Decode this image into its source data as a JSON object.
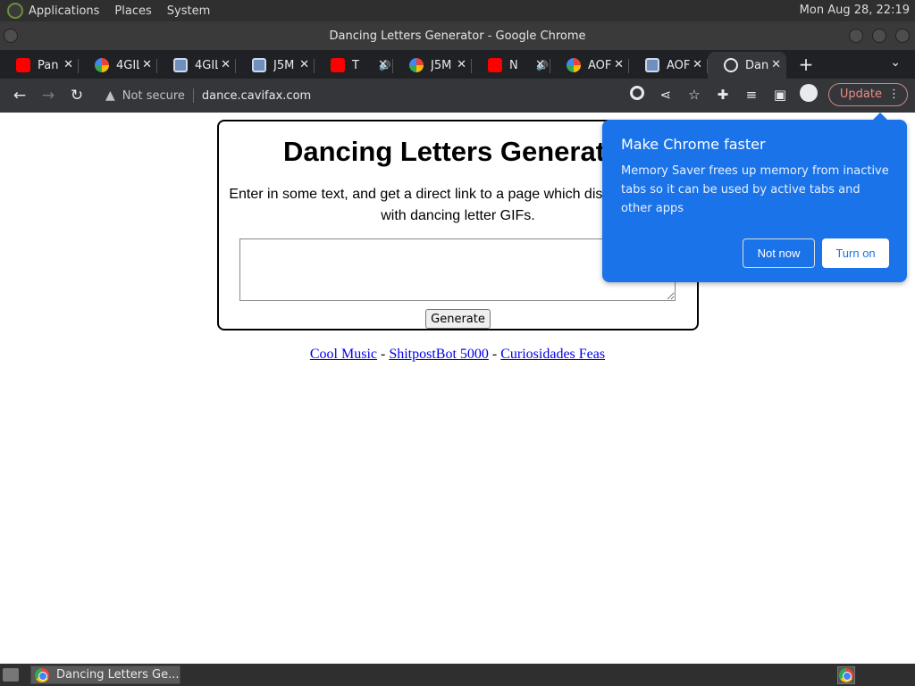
{
  "system_panel": {
    "menus": [
      "Applications",
      "Places",
      "System"
    ],
    "clock": "Mon Aug 28, 22:19"
  },
  "window": {
    "title": "Dancing Letters Generator - Google Chrome"
  },
  "tabs": [
    {
      "label": "Pan",
      "favicon": "youtube-icon",
      "muted": false
    },
    {
      "label": "4GIL",
      "favicon": "pinwheel-icon",
      "muted": false
    },
    {
      "label": "4GIL",
      "favicon": "image-icon",
      "muted": false
    },
    {
      "label": "J5M",
      "favicon": "image-icon",
      "muted": false
    },
    {
      "label": "T",
      "favicon": "youtube-icon",
      "muted": true
    },
    {
      "label": "J5M",
      "favicon": "pinwheel-icon",
      "muted": false
    },
    {
      "label": "N",
      "favicon": "youtube-icon",
      "muted": true
    },
    {
      "label": "AOF",
      "favicon": "pinwheel-icon",
      "muted": false
    },
    {
      "label": "AOF",
      "favicon": "image-icon",
      "muted": false
    },
    {
      "label": "Dan",
      "favicon": "globe-icon",
      "muted": false,
      "active": true
    }
  ],
  "toolbar": {
    "security_label": "Not secure",
    "url": "dance.cavifax.com",
    "update_label": "Update"
  },
  "page": {
    "heading": "Dancing Letters Generator",
    "description": "Enter in some text, and get a direct link to a page which displays the text with dancing letter GIFs.",
    "generate_label": "Generate",
    "links": [
      {
        "label": "Cool Music"
      },
      {
        "label": "ShitpostBot 5000"
      },
      {
        "label": "Curiosidades Feas"
      }
    ],
    "link_separator": "-"
  },
  "popup": {
    "title": "Make Chrome faster",
    "body": "Memory Saver frees up memory from inactive tabs so it can be used by active tabs and other apps",
    "not_now_label": "Not now",
    "turn_on_label": "Turn on"
  },
  "taskbar": {
    "task_label": "Dancing Letters Ge..."
  },
  "colors": {
    "popup_bg": "#1a73e8",
    "link": "#0000ee",
    "update_text": "#f28b82"
  }
}
